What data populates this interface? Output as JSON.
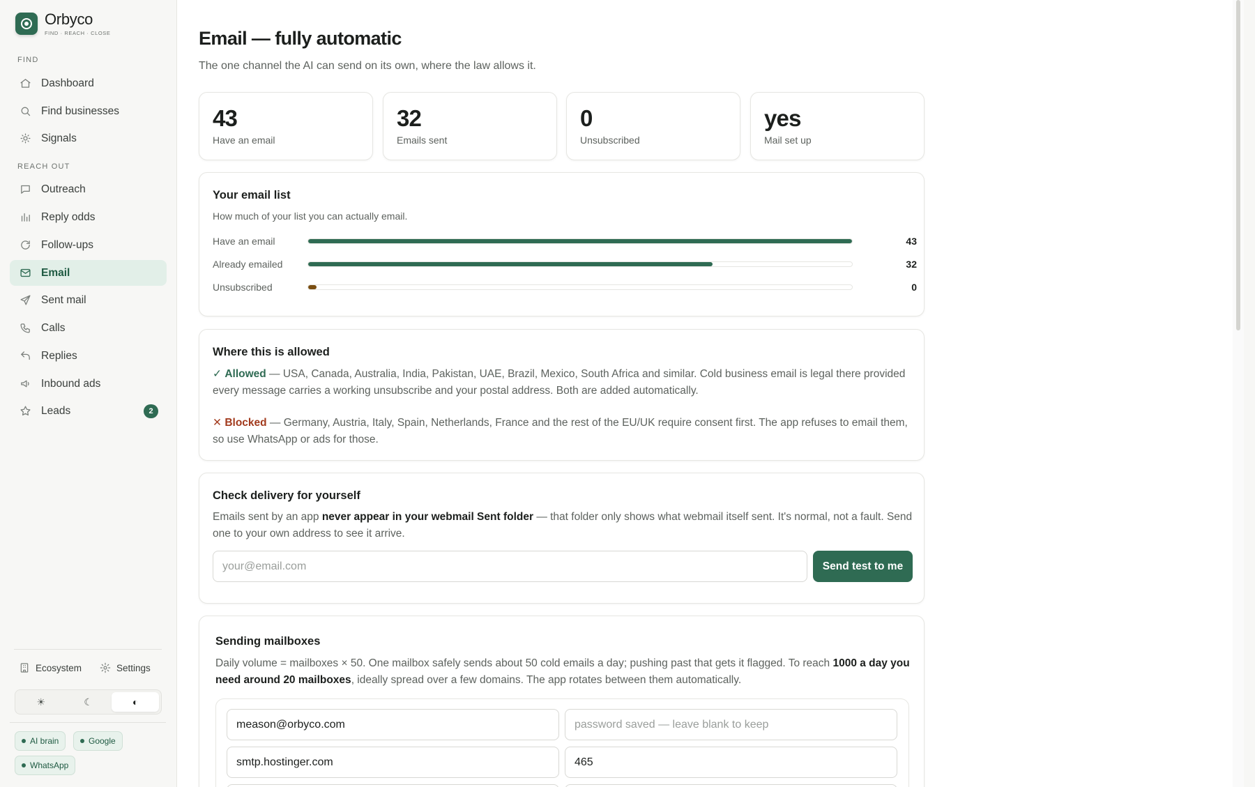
{
  "brand": {
    "name": "Orbyco",
    "tagline": "FIND · REACH · CLOSE"
  },
  "sidebar": {
    "sections": [
      {
        "label": "FIND"
      },
      {
        "label": "REACH OUT"
      }
    ],
    "items": [
      {
        "label": "Dashboard",
        "icon": "home-icon"
      },
      {
        "label": "Find businesses",
        "icon": "search-icon"
      },
      {
        "label": "Signals",
        "icon": "sun-icon"
      },
      {
        "label": "Outreach",
        "icon": "message-square-icon"
      },
      {
        "label": "Reply odds",
        "icon": "bar-chart-icon"
      },
      {
        "label": "Follow-ups",
        "icon": "refresh-icon"
      },
      {
        "label": "Email",
        "icon": "mail-icon",
        "active": true
      },
      {
        "label": "Sent mail",
        "icon": "send-icon"
      },
      {
        "label": "Calls",
        "icon": "phone-icon"
      },
      {
        "label": "Replies",
        "icon": "reply-icon"
      },
      {
        "label": "Inbound ads",
        "icon": "megaphone-icon"
      },
      {
        "label": "Leads",
        "icon": "star-icon",
        "badge": "2"
      }
    ],
    "footer_links": [
      {
        "label": "Ecosystem",
        "icon": "building-icon"
      },
      {
        "label": "Settings",
        "icon": "gear-icon"
      }
    ],
    "theme_options": [
      "☀",
      "☾",
      "◐"
    ],
    "status_chips": [
      "AI brain",
      "Google",
      "WhatsApp"
    ]
  },
  "page": {
    "title": "Email — fully automatic",
    "subtitle": "The one channel the AI can send on its own, where the law allows it."
  },
  "stats": [
    {
      "value": "43",
      "label": "Have an email"
    },
    {
      "value": "32",
      "label": "Emails sent"
    },
    {
      "value": "0",
      "label": "Unsubscribed"
    },
    {
      "value": "yes",
      "label": "Mail set up"
    }
  ],
  "email_list": {
    "title": "Your email list",
    "description": "How much of your list you can actually email.",
    "rows": [
      {
        "label": "Have an email",
        "value": "43",
        "fraction": 1.0
      },
      {
        "label": "Already emailed",
        "value": "32",
        "fraction": 0.744
      },
      {
        "label": "Unsubscribed",
        "value": "0",
        "fraction": 0.015
      }
    ]
  },
  "allowed": {
    "title": "Where this is allowed",
    "allowed_glyph": "✓",
    "allowed_label": "Allowed",
    "allowed_text": " — USA, Canada, Australia, India, Pakistan, UAE, Brazil, Mexico, South Africa and similar. Cold business email is legal there provided every message carries a working unsubscribe and your postal address. Both are added automatically.",
    "blocked_glyph": "✕",
    "blocked_label": "Blocked",
    "blocked_text": " — Germany, Austria, Italy, Spain, Netherlands, France and the rest of the EU/UK require consent first. The app refuses to email them, so use WhatsApp or ads for those."
  },
  "delivery": {
    "title": "Check delivery for yourself",
    "text_before": "Emails sent by an app ",
    "text_bold": "never appear in your webmail Sent folder",
    "text_after": " — that folder only shows what webmail itself sent. It's normal, not a fault. Send one to your own address to see it arrive.",
    "input_placeholder": "your@email.com",
    "button_label": "Send test to me"
  },
  "mailboxes": {
    "title": "Sending mailboxes",
    "text_before": "Daily volume = mailboxes × 50. One mailbox safely sends about 50 cold emails a day; pushing past that gets it flagged. To reach ",
    "text_bold": "1000 a day you need around 20 mailboxes",
    "text_after": ", ideally spread over a few domains. The app rotates between them automatically.",
    "mailbox": {
      "email": "meason@orbyco.com",
      "password_placeholder": "password saved — leave blank to keep",
      "smtp_host": "smtp.hostinger.com",
      "smtp_port": "465"
    }
  }
}
